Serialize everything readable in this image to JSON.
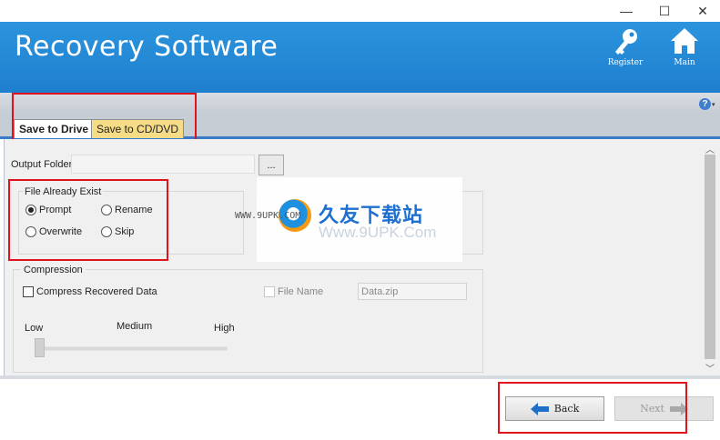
{
  "window": {
    "minimize": "—",
    "maximize": "☐",
    "close": "✕"
  },
  "header": {
    "title": "Recovery Software",
    "register_label": "Register",
    "main_label": "Main",
    "banner_color": "#2b94dd"
  },
  "help": {
    "symbol": "?",
    "dropdown": "▾"
  },
  "tabs": [
    {
      "label": "Save to Drive",
      "active": true
    },
    {
      "label": "Save to CD/DVD",
      "active": false
    }
  ],
  "output": {
    "label": "Output Folder",
    "value": "",
    "browse_label": "..."
  },
  "file_exist": {
    "label": "File Already Exist",
    "options": [
      {
        "label": "Prompt",
        "selected": true
      },
      {
        "label": "Rename",
        "selected": false
      },
      {
        "label": "Overwrite",
        "selected": false
      },
      {
        "label": "Skip",
        "selected": false
      }
    ]
  },
  "compression": {
    "label": "Compression",
    "compress_label": "Compress Recovered Data",
    "compress_checked": false,
    "file_name_label": "File Name",
    "file_name_value": "Data.zip",
    "levels": [
      "Low",
      "Medium",
      "High"
    ],
    "level_value": "Low"
  },
  "nav": {
    "back_label": "Back",
    "next_label": "Next"
  },
  "watermark": {
    "brand": "久友下载站",
    "url": "Www.9UPK.Com",
    "site": "WWW.9UPK.COM"
  },
  "icons": [
    "minimize-icon",
    "maximize-icon",
    "close-icon",
    "key-icon",
    "home-icon",
    "help-icon",
    "back-arrow-icon",
    "next-arrow-icon"
  ],
  "accent_red": "#e0121b"
}
